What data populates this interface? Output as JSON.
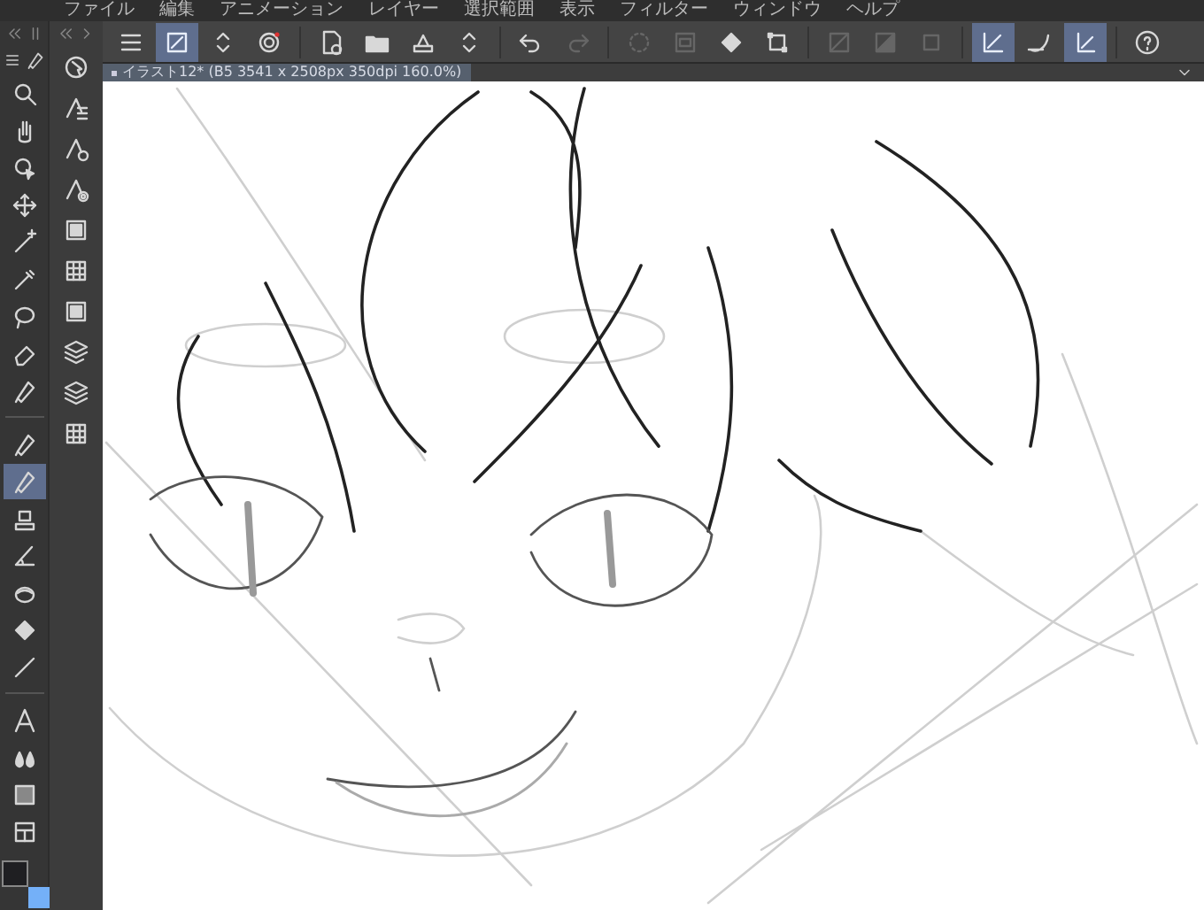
{
  "menu": [
    "ファイル",
    "編集",
    "アニメーション",
    "レイヤー",
    "選択範囲",
    "表示",
    "フィルター",
    "ウィンドウ",
    "ヘルプ"
  ],
  "toolbar": [
    {
      "kind": "menu",
      "on": false,
      "disabled": false
    },
    {
      "kind": "brush-select",
      "on": true,
      "disabled": false
    },
    {
      "kind": "updown",
      "on": false,
      "disabled": false
    },
    {
      "kind": "record",
      "on": false,
      "disabled": false
    },
    {
      "kind": "sep"
    },
    {
      "kind": "new-document",
      "on": false,
      "disabled": false
    },
    {
      "kind": "folder",
      "on": false,
      "disabled": false
    },
    {
      "kind": "printer",
      "on": false,
      "disabled": false
    },
    {
      "kind": "updown",
      "on": false,
      "disabled": false
    },
    {
      "kind": "sep"
    },
    {
      "kind": "undo",
      "on": false,
      "disabled": false
    },
    {
      "kind": "redo",
      "on": false,
      "disabled": true
    },
    {
      "kind": "sep"
    },
    {
      "kind": "spinner",
      "on": false,
      "disabled": true
    },
    {
      "kind": "layer-square",
      "on": false,
      "disabled": true
    },
    {
      "kind": "fill",
      "on": false,
      "disabled": false
    },
    {
      "kind": "transform",
      "on": false,
      "disabled": false
    },
    {
      "kind": "sep"
    },
    {
      "kind": "slash-square",
      "on": false,
      "disabled": true
    },
    {
      "kind": "half-square",
      "on": false,
      "disabled": true
    },
    {
      "kind": "plain-square",
      "on": false,
      "disabled": true
    },
    {
      "kind": "sep"
    },
    {
      "kind": "snap-ruler",
      "on": true,
      "disabled": false
    },
    {
      "kind": "snap-curve",
      "on": false,
      "disabled": false
    },
    {
      "kind": "snap-grid",
      "on": true,
      "disabled": false
    },
    {
      "kind": "sep"
    },
    {
      "kind": "help",
      "on": false,
      "disabled": false
    }
  ],
  "document_tab": {
    "title": "イラスト12* (B5 3541 x 2508px 350dpi 160.0%)"
  },
  "tools": [
    [
      {
        "kind": "zoom",
        "selected": false
      },
      {
        "kind": "hand",
        "selected": false
      },
      {
        "kind": "object",
        "selected": false
      },
      {
        "kind": "move",
        "selected": false
      },
      {
        "kind": "wand",
        "selected": false
      },
      {
        "kind": "eyedropper",
        "selected": false
      },
      {
        "kind": "lasso",
        "selected": false
      },
      {
        "kind": "eraser",
        "selected": false
      },
      {
        "kind": "pen",
        "selected": false
      }
    ],
    [
      {
        "kind": "pen",
        "selected": false
      },
      {
        "kind": "pen",
        "selected": true
      },
      {
        "kind": "stamp",
        "selected": false
      },
      {
        "kind": "ruler",
        "selected": false
      },
      {
        "kind": "blend",
        "selected": false
      },
      {
        "kind": "fill",
        "selected": false
      },
      {
        "kind": "line",
        "selected": false
      }
    ],
    [
      {
        "kind": "text",
        "selected": false
      },
      {
        "kind": "drops",
        "selected": false
      },
      {
        "kind": "gradient",
        "selected": false
      },
      {
        "kind": "frame",
        "selected": false
      }
    ]
  ],
  "sub_tools": [
    {
      "kind": "shape-list",
      "selected": false
    },
    {
      "kind": "shape-gear",
      "selected": false
    },
    {
      "kind": "shape-target",
      "selected": false
    },
    {
      "kind": "panel",
      "selected": false
    },
    {
      "kind": "grid",
      "selected": false
    },
    {
      "kind": "panel",
      "selected": false
    },
    {
      "kind": "layers-add",
      "selected": false
    },
    {
      "kind": "layers",
      "selected": false
    },
    {
      "kind": "grid",
      "selected": false
    }
  ],
  "color_swatches": [
    {
      "kind": "main",
      "color": "#1f1f22"
    },
    {
      "kind": "sub",
      "color": "#74b0f8"
    }
  ]
}
